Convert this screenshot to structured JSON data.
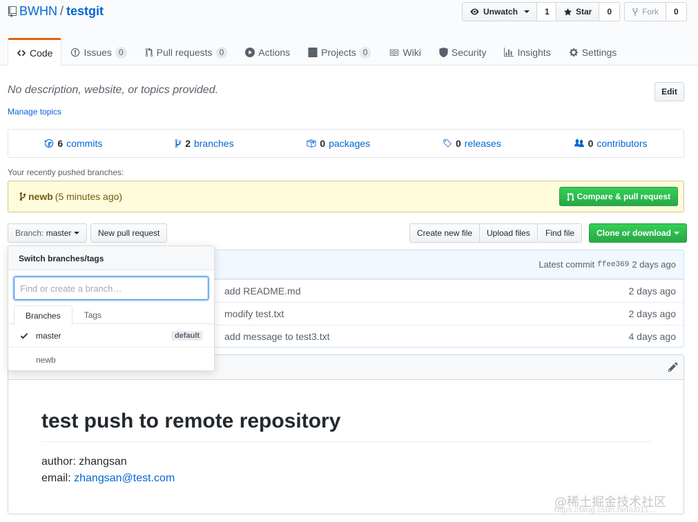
{
  "repo": {
    "owner": "BWHN",
    "separator": "/",
    "name": "testgit"
  },
  "actions": {
    "watch": {
      "label": "Unwatch",
      "count": "1"
    },
    "star": {
      "label": "Star",
      "count": "0"
    },
    "fork": {
      "label": "Fork",
      "count": "0"
    }
  },
  "tabs": [
    {
      "label": "Code"
    },
    {
      "label": "Issues",
      "count": "0"
    },
    {
      "label": "Pull requests",
      "count": "0"
    },
    {
      "label": "Actions"
    },
    {
      "label": "Projects",
      "count": "0"
    },
    {
      "label": "Wiki"
    },
    {
      "label": "Security"
    },
    {
      "label": "Insights"
    },
    {
      "label": "Settings"
    }
  ],
  "description": {
    "text": "No description, website, or topics provided.",
    "manage_topics": "Manage topics",
    "edit": "Edit"
  },
  "summary": [
    {
      "num": "6",
      "label": "commits"
    },
    {
      "num": "2",
      "label": "branches"
    },
    {
      "num": "0",
      "label": "packages"
    },
    {
      "num": "0",
      "label": "releases"
    },
    {
      "num": "0",
      "label": "contributors"
    }
  ],
  "recent": {
    "label": "Your recently pushed branches:",
    "branch": "newb",
    "time": "(5 minutes ago)",
    "compare_button": "Compare & pull request"
  },
  "file_nav": {
    "branch_label": "Branch:",
    "branch_value": "master",
    "new_pr": "New pull request",
    "create_file": "Create new file",
    "upload": "Upload files",
    "find_file": "Find file",
    "clone": "Clone or download"
  },
  "latest_commit": {
    "label": "Latest commit",
    "sha": "ffee369",
    "time": "2 days ago"
  },
  "commits": [
    {
      "message": "add README.md",
      "time": "2 days ago"
    },
    {
      "message": "modify test.txt",
      "time": "2 days ago"
    },
    {
      "message": "add message to test3.txt",
      "time": "4 days ago"
    }
  ],
  "readme": {
    "title": "test push to remote repository",
    "author": "author: zhangsan",
    "email_label": "email: ",
    "email": "zhangsan@test.com"
  },
  "dropdown": {
    "header": "Switch branches/tags",
    "placeholder": "Find or create a branch…",
    "tab_branches": "Branches",
    "tab_tags": "Tags",
    "branches": [
      {
        "name": "master",
        "badge": "default"
      },
      {
        "name": "newb"
      }
    ]
  },
  "watermark": {
    "text": "@稀土掘金技术社区",
    "url": "https://blog.csdn.net/u011..."
  }
}
